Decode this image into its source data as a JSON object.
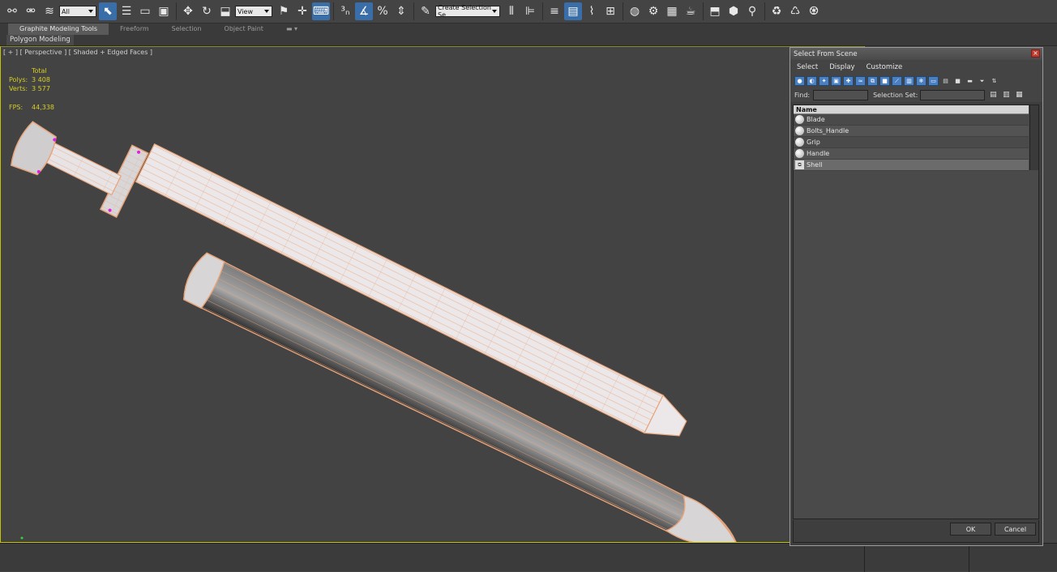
{
  "toolbar": {
    "selection_filter": "All",
    "reference_coord": "View",
    "named_selection": "Create Selection Se",
    "icons": [
      "link-icon",
      "unlink-icon",
      "bind-space-warp-icon",
      "select-object-icon",
      "select-by-name-icon",
      "rect-selection-icon",
      "window-crossing-icon",
      "move-icon",
      "rotate-icon",
      "scale-icon",
      "pivot-center-icon",
      "mirror-icon",
      "align-icon",
      "snaps-icon",
      "angle-snap-icon",
      "percent-snap-icon",
      "spinner-snap-icon",
      "edit-named-sets-icon",
      "layer-manager-icon",
      "curve-editor-icon",
      "schematic-view-icon",
      "material-editor-icon",
      "render-setup-icon",
      "render-frame-icon",
      "render-icon"
    ]
  },
  "ribbon": {
    "tabs": [
      "Graphite Modeling Tools",
      "Freeform",
      "Selection",
      "Object Paint"
    ],
    "active_tab": "Graphite Modeling Tools",
    "panel_label": "Polygon Modeling"
  },
  "viewport": {
    "label": "[ + ] [ Perspective ] [ Shaded + Edged Faces ]",
    "stats": {
      "total_label": "Total",
      "polys_label": "Polys:",
      "polys_value": "3 408",
      "verts_label": "Verts:",
      "verts_value": "3 577",
      "fps_label": "FPS:",
      "fps_value": "44,338"
    },
    "colors": {
      "background": "#434343",
      "wire": "#e8a47a",
      "stats": "#d8cf23",
      "frame": "#c5c20e"
    }
  },
  "dialog": {
    "title": "Select From Scene",
    "close_label": "×",
    "menu": [
      "Select",
      "Display",
      "Customize"
    ],
    "find_label": "Find:",
    "find_value": "",
    "selection_set_label": "Selection Set:",
    "selection_set_value": "",
    "column_header": "Name",
    "objects": [
      "Blade",
      "Bolts_Handle",
      "Grip",
      "Handle",
      "Shell"
    ],
    "selected": "Shell",
    "ok_label": "OK",
    "cancel_label": "Cancel"
  }
}
